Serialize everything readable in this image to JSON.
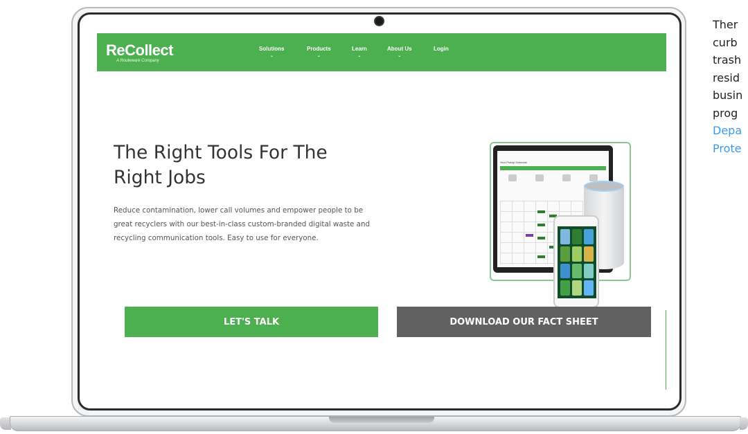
{
  "site": {
    "logo": "ReCollect",
    "logo_sub": "A Routeware Company",
    "nav": [
      {
        "label": "Solutions",
        "dropdown": true
      },
      {
        "label": "Products",
        "dropdown": true
      },
      {
        "label": "Learn",
        "dropdown": true
      },
      {
        "label": "About Us",
        "dropdown": true
      },
      {
        "label": "Login",
        "dropdown": false
      }
    ],
    "headline_line1": "The Right Tools For The",
    "headline_line2": "Right Jobs",
    "body_line1": "Reduce contamination, lower call volumes and empower people to be",
    "body_line2": "great recyclers with our best-in-class custom-branded digital waste and",
    "body_line3": "recycling communication tools. Easy to use for everyone.",
    "cta_primary": "LET'S TALK",
    "cta_secondary": "DOWNLOAD OUR FACT SHEET",
    "tablet_title": "Your Pickup Schedule"
  },
  "side": {
    "line1": "Ther",
    "line2": "curb",
    "line3": "trash",
    "line4": "resid",
    "line5": "busin",
    "line6": "prog",
    "link1": "Depa",
    "link2": "Prote"
  },
  "colors": {
    "brand_green": "#4caf50",
    "button_gray": "#616161",
    "link_blue": "#3a9be5"
  }
}
